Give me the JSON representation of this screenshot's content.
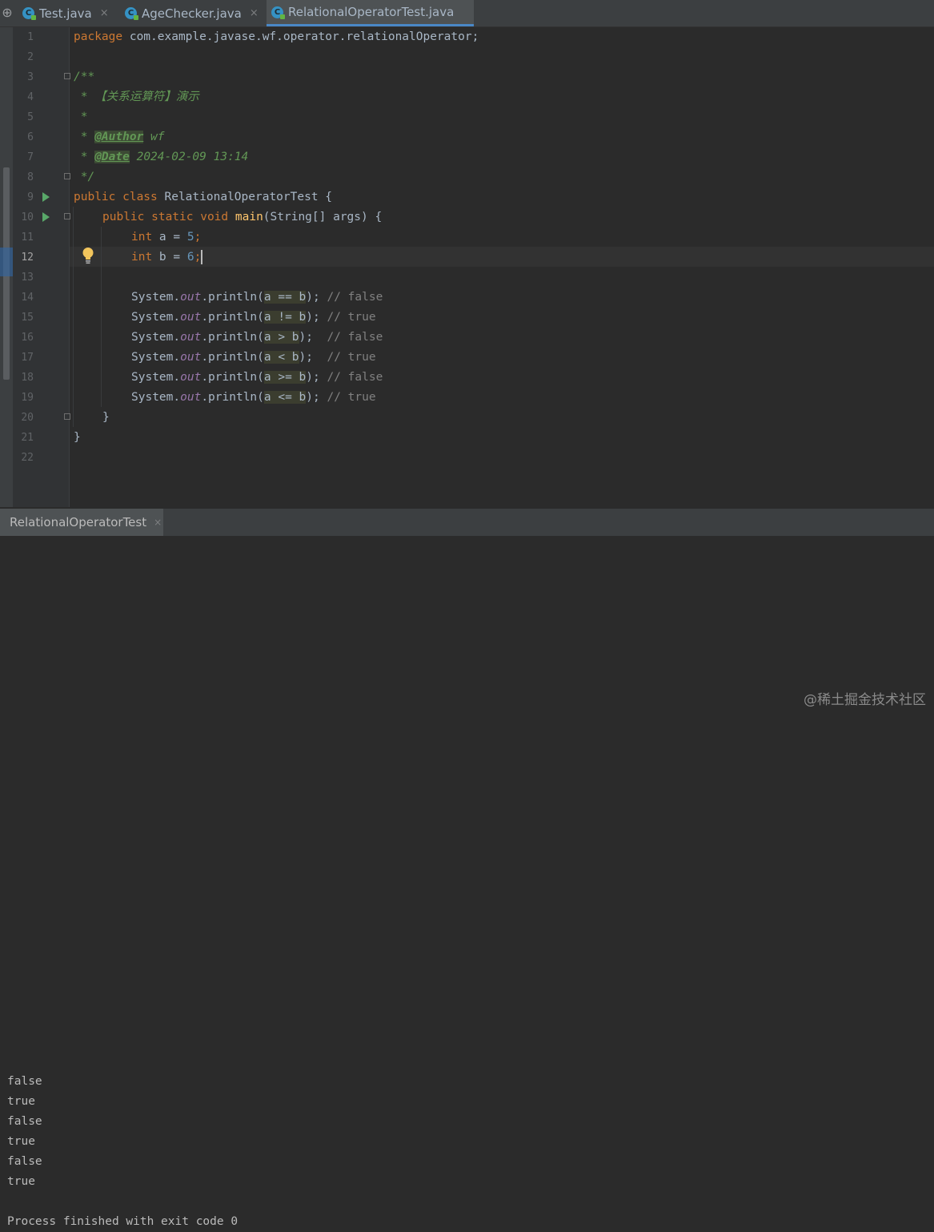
{
  "tabs": [
    {
      "label": "Test.java",
      "active": false
    },
    {
      "label": "AgeChecker.java",
      "active": false
    },
    {
      "label": "RelationalOperatorTest.java",
      "active": true
    }
  ],
  "close_glyph": "×",
  "current_line": 12,
  "code": {
    "line_numbers": [
      "1",
      "2",
      "3",
      "4",
      "5",
      "6",
      "7",
      "8",
      "9",
      "10",
      "11",
      "12",
      "13",
      "14",
      "15",
      "16",
      "17",
      "18",
      "19",
      "20",
      "21",
      "22"
    ],
    "l1_kw": "package",
    "l1_rest": " com.example.javase.wf.operator.relationalOperator;",
    "l3": "/**",
    "l4": " * 【关系运算符】演示",
    "l5": " *",
    "l6_pre": " * ",
    "l6_tag": "@Author",
    "l6_val": " wf",
    "l7_pre": " * ",
    "l7_tag": "@Date",
    "l7_val": " 2024-02-09 13:14",
    "l8": " */",
    "l9_kw": "public class",
    "l9_rest": " RelationalOperatorTest {",
    "l10_kw": "public static void",
    "l10_fn": "main",
    "l10_rest": "(String[] args) {",
    "l11_kw": "int",
    "l11_mid": " a = ",
    "l11_num": "5",
    "l11_end": ";",
    "l12_kw": "int",
    "l12_mid": " b = ",
    "l12_num": "6",
    "l12_end": ";",
    "println_pre": "System.",
    "println_field": "out",
    "println_call": ".println(",
    "statements": [
      {
        "expr": "a == b",
        "tail": "); ",
        "comment": "// false"
      },
      {
        "expr": "a != b",
        "tail": "); ",
        "comment": "// true"
      },
      {
        "expr": "a > b",
        "tail": ");  ",
        "comment": "// false"
      },
      {
        "expr": "a < b",
        "tail": ");  ",
        "comment": "// true"
      },
      {
        "expr": "a >= b",
        "tail": "); ",
        "comment": "// false"
      },
      {
        "expr": "a <= b",
        "tail": "); ",
        "comment": "// true"
      }
    ],
    "close_brace": "}"
  },
  "run_panel": {
    "tab_label": "RelationalOperatorTest",
    "output": [
      "false",
      "true",
      "false",
      "true",
      "false",
      "true",
      "",
      "Process finished with exit code 0"
    ]
  },
  "watermark": "@稀土掘金技术社区",
  "colors": {
    "keyword": "#cc7832",
    "number": "#6897bb",
    "doc_comment": "#629755",
    "comment": "#808080",
    "field": "#9876aa",
    "method": "#ffc66d",
    "run_icon": "#59a869"
  }
}
